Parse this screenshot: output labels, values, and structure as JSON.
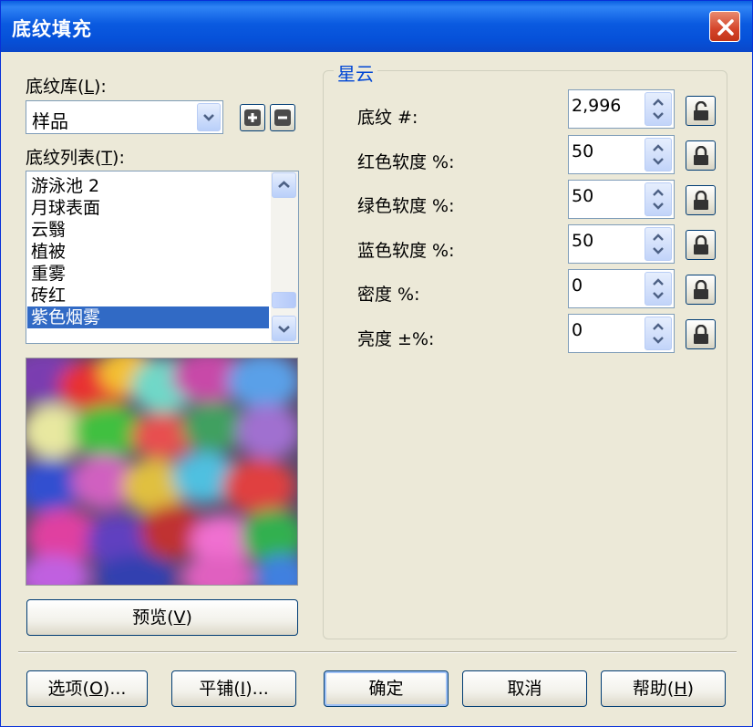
{
  "window": {
    "title": "底纹填充"
  },
  "library": {
    "label_text": "底纹库(",
    "label_key": "L",
    "label_tail": "):",
    "selected": "样品",
    "add_icon": "plus-icon",
    "remove_icon": "minus-icon"
  },
  "texture_list": {
    "label_text": "底纹列表(",
    "label_key": "T",
    "label_tail": "):",
    "items": [
      "游泳池 2",
      "月球表面",
      "云翳",
      "植被",
      "重雾",
      "砖红",
      "紫色烟雾"
    ],
    "selected_index": 6
  },
  "preview_button": {
    "label_text": "预览(",
    "label_key": "V",
    "label_tail": ")"
  },
  "params": {
    "group_title": "星云",
    "fields": [
      {
        "label": "底纹 #:",
        "value": "2,996",
        "lock": "unlocked"
      },
      {
        "label": "红色软度 %:",
        "value": "50",
        "lock": "locked"
      },
      {
        "label": "绿色软度 %:",
        "value": "50",
        "lock": "locked"
      },
      {
        "label": "蓝色软度 %:",
        "value": "50",
        "lock": "locked"
      },
      {
        "label": "密度 %:",
        "value": "0",
        "lock": "locked"
      },
      {
        "label": "亮度 ±%:",
        "value": "0",
        "lock": "locked"
      }
    ]
  },
  "footer": {
    "options": {
      "text": "选项(",
      "key": "O",
      "tail": ")..."
    },
    "tile": {
      "text": "平铺(",
      "key": "I",
      "tail": ")..."
    },
    "ok": "确定",
    "cancel": "取消",
    "help": {
      "text": "帮助(",
      "key": "H",
      "tail": ")"
    }
  },
  "colors": {
    "titlebar": "#0a5ae0",
    "window_bg": "#ece9d8",
    "selection": "#316ac5",
    "group_title": "#0046d5",
    "close_button": "#d4442a"
  }
}
